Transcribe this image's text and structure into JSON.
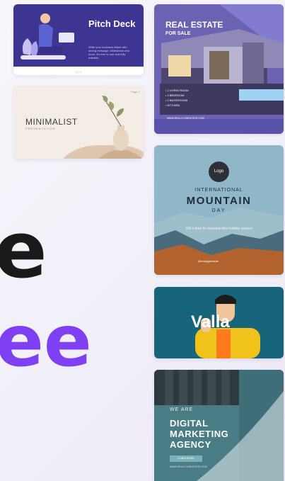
{
  "hero": {
    "line1_fragment": "e",
    "line2_fragment": "ee"
  },
  "colors": {
    "accent": "#7f3ff2",
    "text_dark": "#1a1a1a"
  },
  "templates": [
    {
      "id": "pitch-deck",
      "title": "Pitch Deck",
      "body": "Write your business slides with strong message, slideshows and more. It's free to use and fully editable.",
      "pager": "1 / 2"
    },
    {
      "id": "minimalist",
      "title": "MINIMALIST",
      "subtitle": "PRESENTATION",
      "page": "Page 1"
    },
    {
      "id": "real-estate",
      "title": "REAL ESTATE",
      "subtitle": "FOR SALE",
      "features": [
        "• 2 LIVING ROOM",
        "• 3 BEDROOM",
        "• 2 BATHROOMS",
        "• KITCHEN"
      ],
      "url": "WWW.REALLYGREATSITE.COM"
    },
    {
      "id": "mountain-day",
      "logo": "Logo",
      "line1": "INTERNATIONAL",
      "line2": "MOUNTAIN",
      "line3": "DAY",
      "gift": "Gift a time to mountain this holiday season",
      "handle": "@reallygreatsite"
    },
    {
      "id": "valla",
      "title": "Valla"
    },
    {
      "id": "digital-marketing",
      "kicker": "WE ARE",
      "title": "DIGITAL MARKETING AGENCY",
      "button": "LEARN MORE",
      "footer": "WWW.REALLYGREATSITE.COM"
    }
  ]
}
